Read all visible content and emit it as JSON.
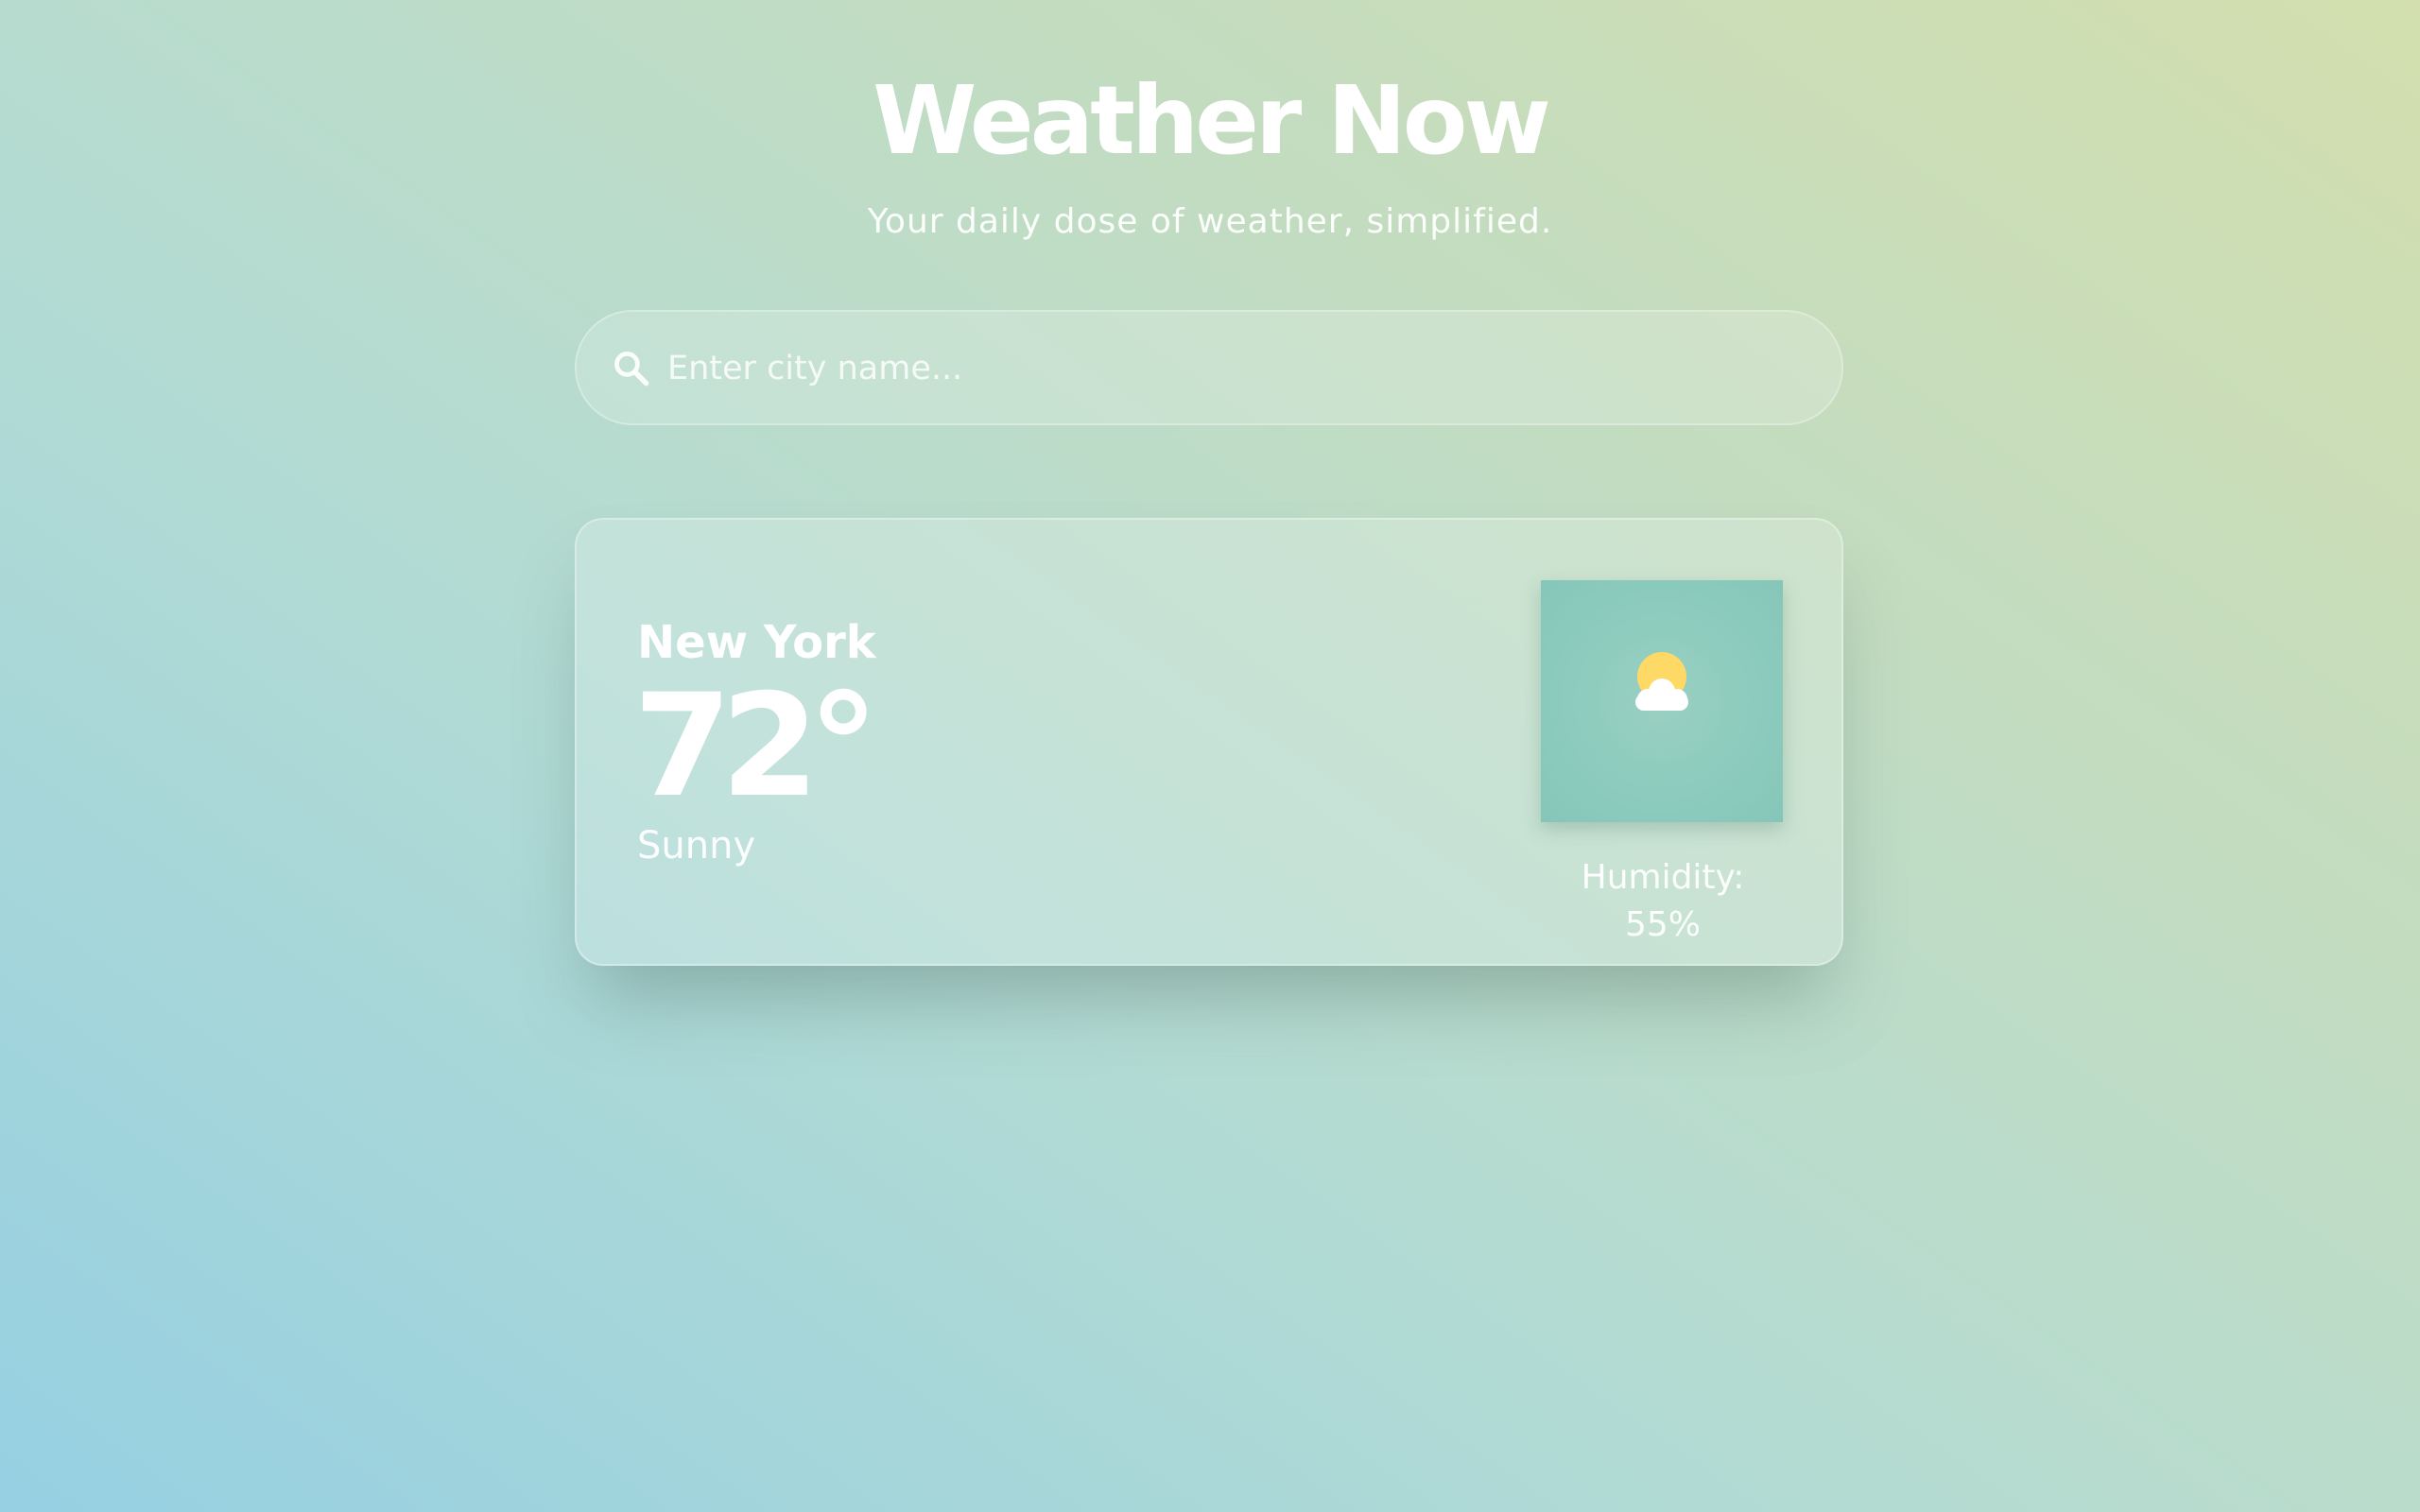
{
  "header": {
    "title": "Weather Now",
    "subtitle": "Your daily dose of weather, simplified."
  },
  "search": {
    "placeholder": "Enter city name...",
    "value": "",
    "icon": "search-icon"
  },
  "weather": {
    "city": "New York",
    "temperature": "72°",
    "condition": "Sunny",
    "humidity": "Humidity: 55%",
    "icon": "partly-sunny-icon"
  },
  "colors": {
    "sun": "#ffd966",
    "cloud": "#ffffff",
    "icon_background": "#8ccbbd"
  }
}
